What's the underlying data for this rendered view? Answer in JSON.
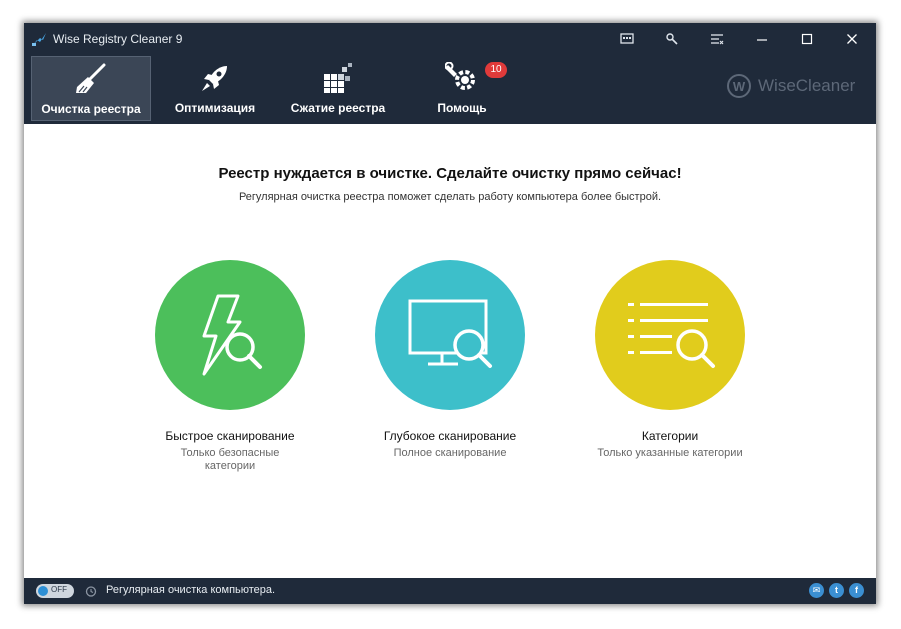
{
  "window": {
    "title": "Wise Registry Cleaner 9"
  },
  "titlebar_buttons": [
    "feedback-icon",
    "settings-icon",
    "menu-icon",
    "minimize-icon",
    "maximize-icon",
    "close-icon"
  ],
  "toolbar": {
    "items": [
      {
        "label": "Очистка реестра",
        "icon": "broom-icon",
        "active": true
      },
      {
        "label": "Оптимизация",
        "icon": "rocket-icon",
        "active": false
      },
      {
        "label": "Сжатие реестра",
        "icon": "blocks-icon",
        "active": false
      },
      {
        "label": "Помощь",
        "icon": "wrench-gear-icon",
        "active": false
      }
    ],
    "help_badge": "10",
    "brand": {
      "mark": "W",
      "text": "WiseCleaner"
    }
  },
  "main": {
    "headline": "Реестр нуждается в очистке. Сделайте очистку прямо сейчас!",
    "subline": "Регулярная очистка реестра поможет сделать работу компьютера более быстрой.",
    "scans": [
      {
        "title": "Быстрое сканирование",
        "desc_line1": "Только безопасные",
        "desc_line2": "категории",
        "color": "#4cbf5b",
        "icon": "lightning-search-icon"
      },
      {
        "title": "Глубокое сканирование",
        "desc_line1": "Полное сканирование",
        "desc_line2": "",
        "color": "#3dbfca",
        "icon": "monitor-search-icon"
      },
      {
        "title": "Категории",
        "desc_line1": "Только указанные категории",
        "desc_line2": "",
        "color": "#e1cc1c",
        "icon": "list-search-icon"
      }
    ]
  },
  "statusbar": {
    "toggle_label": "OFF",
    "text": "Регулярная очистка компьютера.",
    "social": [
      {
        "icon": "mail-icon",
        "glyph": "✉"
      },
      {
        "icon": "twitter-icon",
        "glyph": "t"
      },
      {
        "icon": "facebook-icon",
        "glyph": "f"
      }
    ]
  },
  "colors": {
    "chrome": "#1f2a3a",
    "active_tab": "#3b4656",
    "badge": "#e03a3a",
    "social": "#3b8fd2"
  }
}
